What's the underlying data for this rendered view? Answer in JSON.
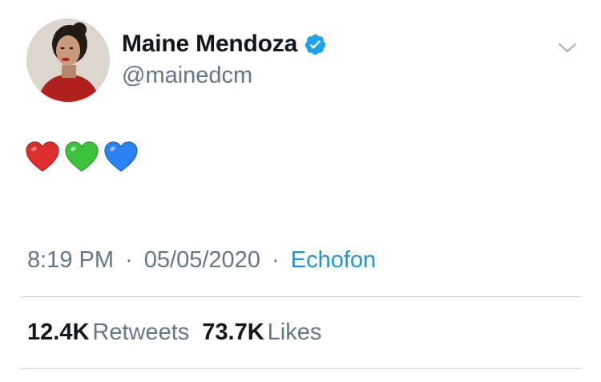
{
  "tweet": {
    "author": {
      "display_name": "Maine Mendoza",
      "handle": "@mainedcm",
      "verified": true,
      "verified_icon": "verified-badge-icon",
      "avatar": "profile-photo"
    },
    "content": {
      "emojis": [
        "red-heart-icon",
        "green-heart-icon",
        "blue-heart-icon"
      ]
    },
    "meta": {
      "time": "8:19 PM",
      "separator": "·",
      "date": "05/05/2020",
      "source": "Echofon"
    },
    "stats": {
      "retweets_count": "12.4K",
      "retweets_label": "Retweets",
      "likes_count": "73.7K",
      "likes_label": "Likes"
    }
  },
  "colors": {
    "text_primary": "#14171a",
    "text_secondary": "#657786",
    "link": "#1b95e0",
    "verified": "#1da1f2",
    "divider": "#d4d9dd"
  }
}
